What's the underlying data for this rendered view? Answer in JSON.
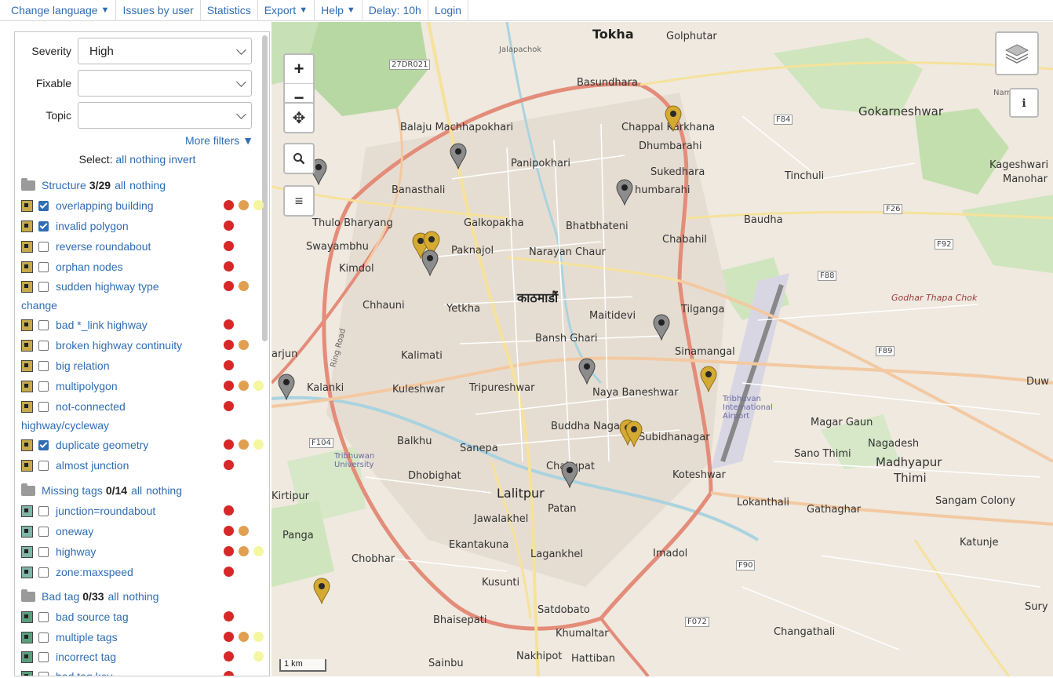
{
  "menu": {
    "change_language": "Change language",
    "issues_by_user": "Issues by user",
    "statistics": "Statistics",
    "export": "Export",
    "help": "Help",
    "delay_label": "Delay:",
    "delay_value": "10h",
    "login": "Login"
  },
  "map": {
    "zoom_in": "+",
    "zoom_out": "−",
    "scale": "1 km",
    "labels": {
      "tokha": "Tokha",
      "golphutar": "Golphutar",
      "jalapachok": "Jalapachok",
      "basundhara": "Basundhara",
      "namgyal": "Namgyal",
      "gokarneshwar": "Gokarneshwar",
      "balaju": "Balaju Machhapokhari",
      "chappal": "Chappal Karkhana",
      "dhumbarahi": "Dhumbarahi",
      "panipokhari": "Panipokhari",
      "sukedhara": "Sukedhara",
      "tinchuli": "Tinchuli",
      "kageshwari": "Kageshwari",
      "manohar": "Manohar",
      "banasthali": "Banasthali",
      "humbarahi": "humbarahi",
      "thulo": "Thulo Bharyang",
      "galkopakha": "Galkopakha",
      "bhatbhateni": "Bhatbhateni",
      "baudha": "Baudha",
      "swayambhu": "Swayambhu",
      "paknajol": "Paknajol",
      "narayan": "Narayan Chaur",
      "chabahil": "Chabahil",
      "kimdol": "Kimdol",
      "kathmandu": "काठमाडौं",
      "godhar": "Godhar Thapa Chok",
      "chhauni": "Chhauni",
      "yetkha": "Yetkha",
      "tilganga": "Tilganga",
      "maitidevi": "Maitidevi",
      "bansh": "Bansh Ghari",
      "sinamangal": "Sinamangal",
      "arjun": "arjun",
      "kalimati": "Kalimati",
      "kalanki": "Kalanki",
      "kuleshwar": "Kuleshwar",
      "tripureshwar": "Tripureshwar",
      "naya": "Naya Baneshwar",
      "duw": "Duw",
      "balkhu": "Balkhu",
      "buddha": "Buddha Nagar",
      "subidhanagar": "Subidhanagar",
      "magar": "Magar Gaun",
      "nagadesh": "Nagadesh",
      "sanepa": "Sanepa",
      "sano": "Sano Thimi",
      "madhyapur": "Madhyapur",
      "thimi": "Thimi",
      "chakupat": "Chakupat",
      "koteshwar": "Koteshwar",
      "dhobighat": "Dhobighat",
      "lalitpur": "Lalitpur",
      "kirtipur": "Kirtipur",
      "lokanthali": "Lokanthali",
      "gathaghar": "Gathaghar",
      "sangam": "Sangam Colony",
      "jawalakhel": "Jawalakhel",
      "patan": "Patan",
      "panga": "Panga",
      "ekantakuna": "Ekantakuna",
      "lagankhel": "Lagankhel",
      "imadol": "Imadol",
      "katunje": "Katunje",
      "chobhar": "Chobhar",
      "kusunti": "Kusunti",
      "sury": "Sury",
      "satdobato": "Satdobato",
      "bhaisepati": "Bhaisepati",
      "khumaltar": "Khumaltar",
      "changathali": "Changathali",
      "sainbu": "Sainbu",
      "nakhipot": "Nakhipot",
      "hattiban": "Hattiban",
      "tribhuvan_univ": "Tribhuwan University",
      "tribhuvan_airport": "Tribhuvan International Airport",
      "r_27dr021": "27DR021",
      "r_f84": "F84",
      "r_f26": "F26",
      "r_f92": "F92",
      "r_f88": "F88",
      "r_f89": "F89",
      "r_f104": "F104",
      "r_f90": "F90",
      "r_f072": "F072",
      "ring_road": "Ring Road"
    }
  },
  "filters": {
    "severity_label": "Severity",
    "severity_value": "High",
    "fixable_label": "Fixable",
    "fixable_value": "",
    "topic_label": "Topic",
    "topic_value": "",
    "more_filters": "More filters",
    "select_label": "Select:",
    "select_all": "all",
    "select_nothing": "nothing",
    "select_invert": "invert"
  },
  "groups": {
    "structure": {
      "name": "Structure",
      "count": "3/29",
      "all": "all",
      "nothing": "nothing"
    },
    "missing": {
      "name": "Missing tags",
      "count": "0/14",
      "all": "all",
      "nothing": "nothing"
    },
    "badtag": {
      "name": "Bad tag",
      "count": "0/33",
      "all": "all",
      "nothing": "nothing"
    }
  },
  "items": {
    "overlapping_building": "overlapping building",
    "invalid_polygon": "invalid polygon",
    "reverse_roundabout": "reverse roundabout",
    "orphan_nodes": "orphan nodes",
    "sudden_highway": "sudden highway type",
    "sudden_highway_cont": "change",
    "bad_link": "bad *_link highway",
    "broken_highway": "broken highway continuity",
    "big_relation": "big relation",
    "multipolygon": "multipolygon",
    "not_connected": "not-connected",
    "not_connected_cont": "highway/cycleway",
    "duplicate_geometry": "duplicate geometry",
    "almost_junction": "almost junction",
    "junction_roundabout": "junction=roundabout",
    "oneway": "oneway",
    "highway": "highway",
    "zone_maxspeed": "zone:maxspeed",
    "bad_source_tag": "bad source tag",
    "multiple_tags": "multiple tags",
    "incorrect_tag": "incorrect tag",
    "bad_tag_key": "bad tag key"
  }
}
